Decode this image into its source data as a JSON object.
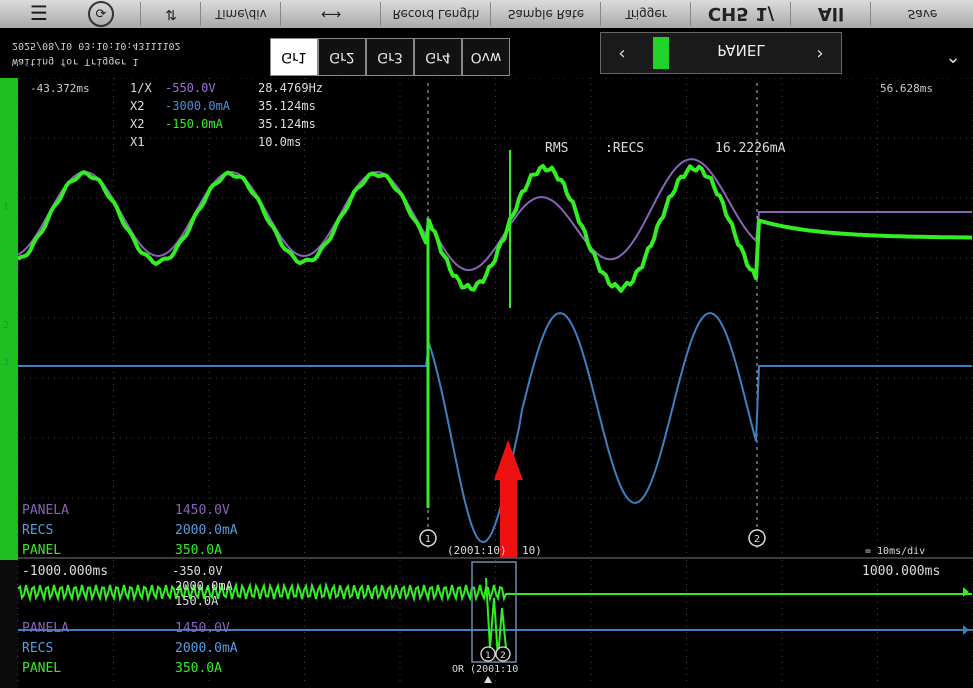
{
  "toolbar": {
    "menu_icon": "menu-icon",
    "history_icon": "history-icon",
    "time_div": "Time/div",
    "record_length": "Record Length",
    "sample_rate": "Sample Rate",
    "trigger": "Trigger",
    "ch_label": "CH5 1/",
    "all_label": "All",
    "right_label": "Save"
  },
  "status": {
    "datetime": "2025/08/10 03:10:10:43111102",
    "trigger_info": "Waiting for Trigger  1"
  },
  "tabs": [
    "Gr1",
    "Gr2",
    "Gr3",
    "Gr4",
    "Ovw"
  ],
  "panel": {
    "label": "PANEL",
    "prev": "‹",
    "next": "›",
    "color": "#22d22a",
    "expand": "⌄"
  },
  "main": {
    "time_left": "-43.372ms",
    "time_right": "56.628ms",
    "readout": [
      {
        "label": "1/X",
        "value": "-550.0V",
        "extra": "28.4769Hz"
      },
      {
        "label": "X2",
        "value": "-3000.0mA",
        "extra": "35.124ms"
      },
      {
        "label": "X2",
        "value": "-150.0mA",
        "extra": "35.124ms"
      },
      {
        "label": "X1",
        "value": "10.0ms",
        "extra": ""
      }
    ],
    "marker_labels": {
      "a": "RMS",
      "b": ":RECS",
      "c": "16.2226mA"
    },
    "scale_labels": [
      {
        "label": "PANELA",
        "value": "1450.0V"
      },
      {
        "label": "RECS",
        "value": "2000.0mA"
      },
      {
        "label": "PANEL",
        "value": "350.0A"
      }
    ],
    "zoom_label": "(2001:10)",
    "zoom_suffix": "10)",
    "time_div_readout": "= 10ms/div",
    "cursor_marks": [
      "1",
      "2"
    ]
  },
  "overview": {
    "time_left": "-1000.000ms",
    "time_right": "1000.000ms",
    "scale_top": "-350.0V",
    "scale_labels": [
      {
        "label": "PANELA",
        "value": "1450.0V"
      },
      {
        "label": "RECS",
        "value": "2000.0mA"
      },
      {
        "label": "PANEL",
        "value": "350.0A"
      }
    ],
    "mini_labels": [
      "2000.0mA",
      "150.0A"
    ],
    "zoom_label": "OR (2001:10"
  },
  "colors": {
    "green": "#33ee22",
    "purple": "#8a63b8",
    "blue": "#3f7fc0",
    "arrow": "#ee1111",
    "grid": "#454545"
  }
}
